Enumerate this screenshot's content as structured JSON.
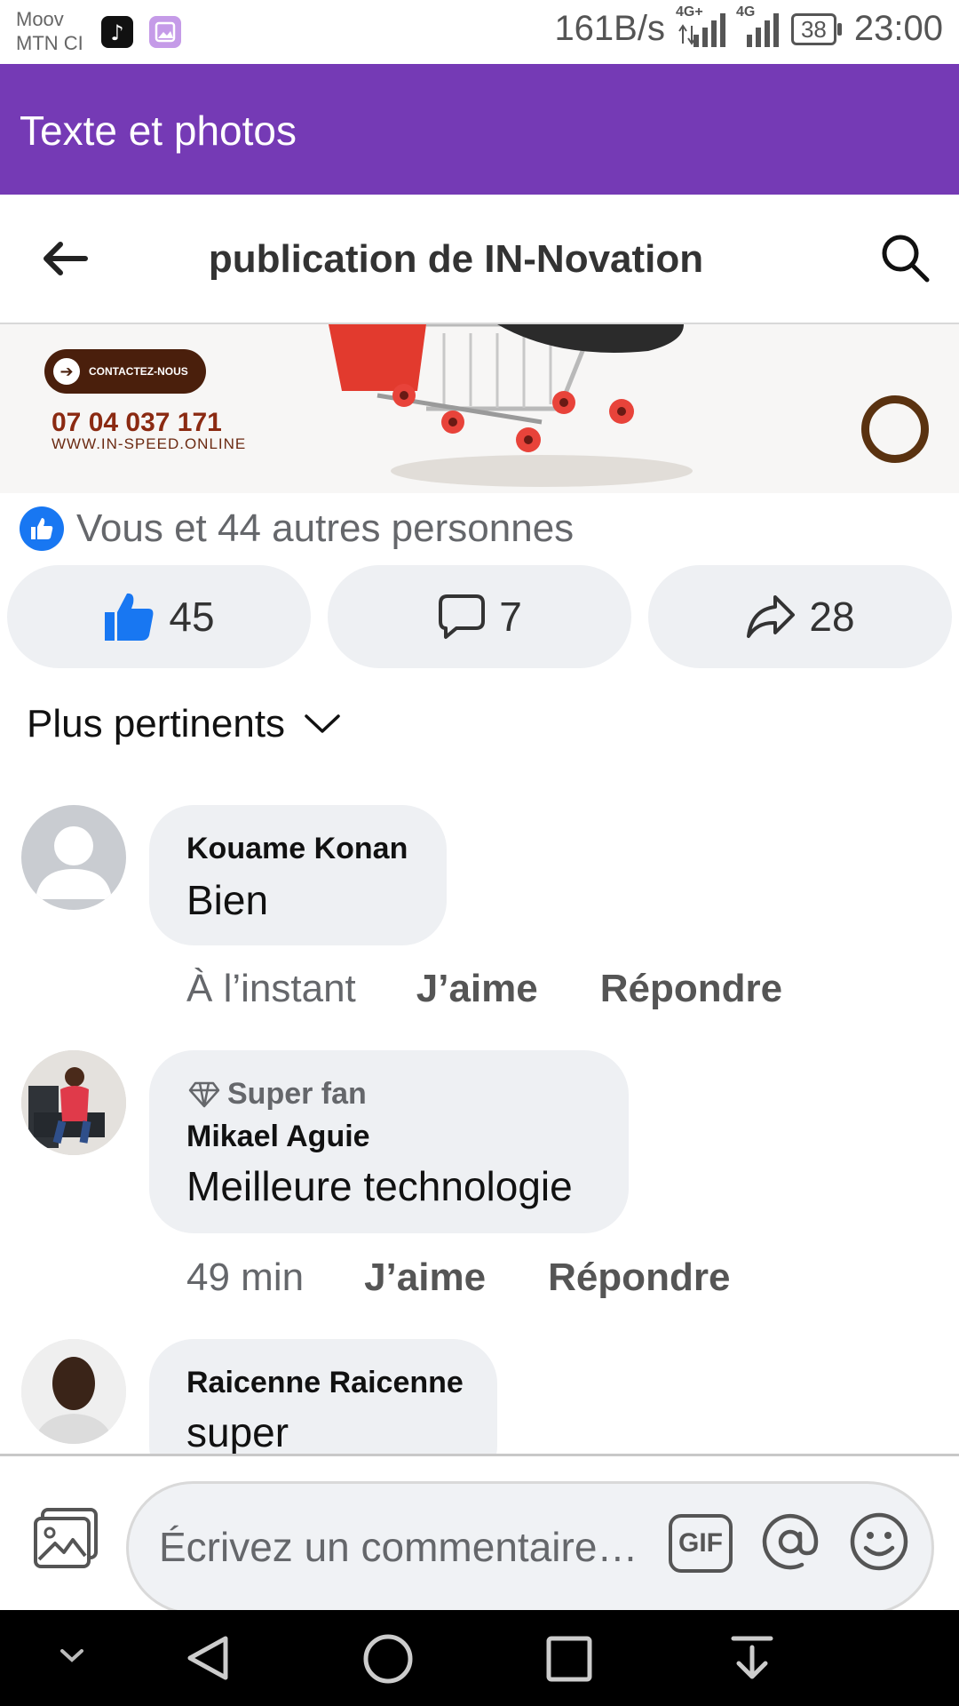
{
  "status_bar": {
    "carrier_1": "Moov",
    "carrier_2": "MTN CI",
    "speed": "161B/s",
    "network_1": "4G+",
    "network_2": "4G",
    "battery": "38",
    "time": "23:00"
  },
  "app_bar": {
    "title": "Texte et photos"
  },
  "header": {
    "title": "publication de IN-Novation"
  },
  "banner": {
    "contact_label": "CONTACTEZ-NOUS",
    "phone": "07 04 037 171",
    "website": "WWW.IN-SPEED.ONLINE"
  },
  "reactions": {
    "summary": "Vous et 44 autres personnes"
  },
  "actions": {
    "likes": "45",
    "comments": "7",
    "shares": "28"
  },
  "sort": {
    "label": "Plus pertinents"
  },
  "comments": [
    {
      "name": "Kouame Konan",
      "text": "Bien",
      "time": "À l’instant",
      "like": "J’aime",
      "reply": "Répondre"
    },
    {
      "badge": "Super fan",
      "name": "Mikael Aguie",
      "text": "Meilleure technologie",
      "time": "49 min",
      "like": "J’aime",
      "reply": "Répondre"
    },
    {
      "name": "Raicenne Raicenne",
      "text": "super"
    }
  ],
  "composer": {
    "placeholder": "Écrivez un commentaire…",
    "gif": "GIF"
  },
  "colors": {
    "app_bar": "#753ab5",
    "like_blue": "#1877f2",
    "pill_bg": "#eef0f3"
  }
}
